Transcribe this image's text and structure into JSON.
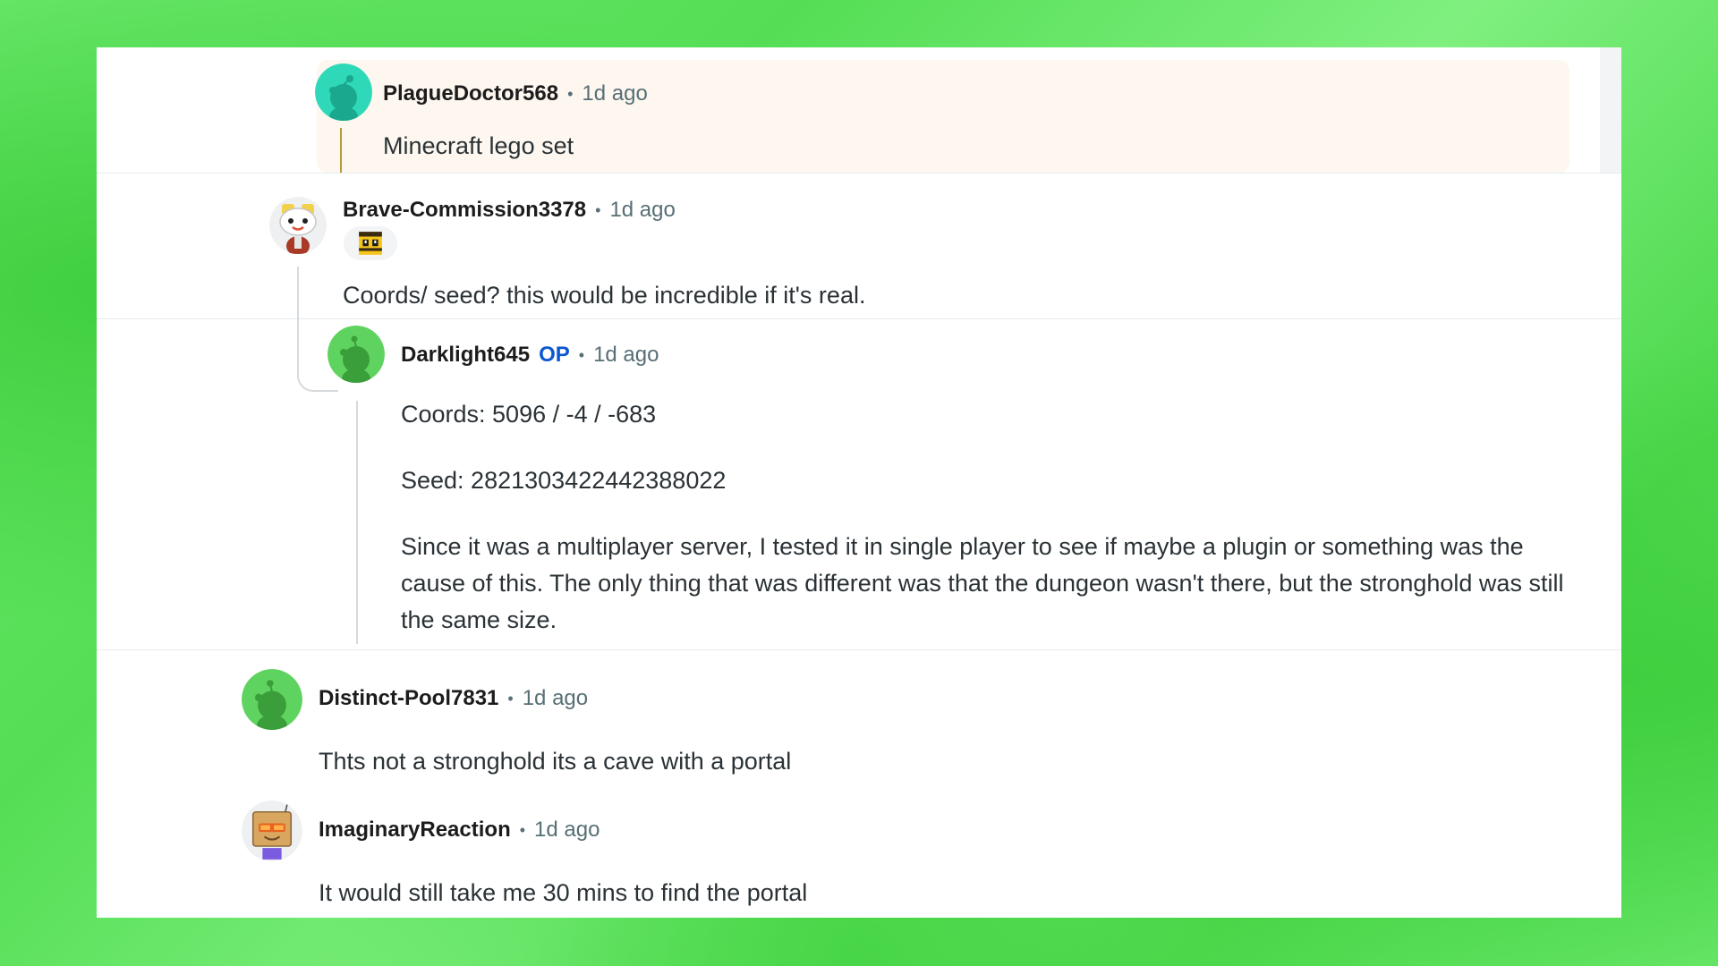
{
  "colors": {
    "background_green": "#5fe35f",
    "card": "#ffffff",
    "highlight": "#fdf7ef",
    "op_blue": "#0a57d0",
    "meta_gray": "#576f76",
    "text": "#2a3236"
  },
  "separator": "•",
  "comments": [
    {
      "username": "PlagueDoctor568",
      "time": "1d ago",
      "avatar_icon": "snoo-teal-avatar-icon",
      "body": [
        "Minecraft lego set"
      ]
    },
    {
      "username": "Brave-Commission3378",
      "time": "1d ago",
      "avatar_icon": "snoo-costume-avatar-icon",
      "flair_icon": "pixel-bee-flair-icon",
      "body": [
        "Coords/ seed? this would be incredible if it's real."
      ]
    },
    {
      "username": "Darklight645",
      "op_badge": "OP",
      "time": "1d ago",
      "avatar_icon": "snoo-green-avatar-icon",
      "body": [
        "Coords: 5096 / -4 / -683",
        "Seed: 2821303422442388022",
        "Since it was a multiplayer server, I tested it in single player to see if maybe a plugin or something was the cause of this. The only thing that was different was that the dungeon wasn't there, but the stronghold was still the same size."
      ]
    },
    {
      "username": "Distinct-Pool7831",
      "time": "1d ago",
      "avatar_icon": "snoo-green-avatar-icon",
      "body": [
        "Thts not a stronghold its a cave with a portal"
      ]
    },
    {
      "username": "ImaginaryReaction",
      "time": "1d ago",
      "avatar_icon": "snoo-box-robot-avatar-icon",
      "body": [
        "It would still take me 30 mins to find the portal"
      ]
    }
  ]
}
